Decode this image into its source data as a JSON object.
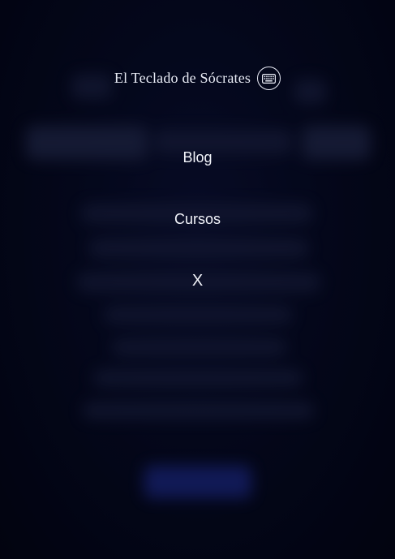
{
  "brand": {
    "title": "El Teclado de Sócrates",
    "icon": "keyboard-icon"
  },
  "menu": {
    "items": [
      {
        "label": "Blog"
      },
      {
        "label": "Cursos"
      }
    ],
    "close_label": "X"
  },
  "colors": {
    "background": "#03071a",
    "text": "#f2f4fa",
    "accent_button": "#1c2a86"
  }
}
